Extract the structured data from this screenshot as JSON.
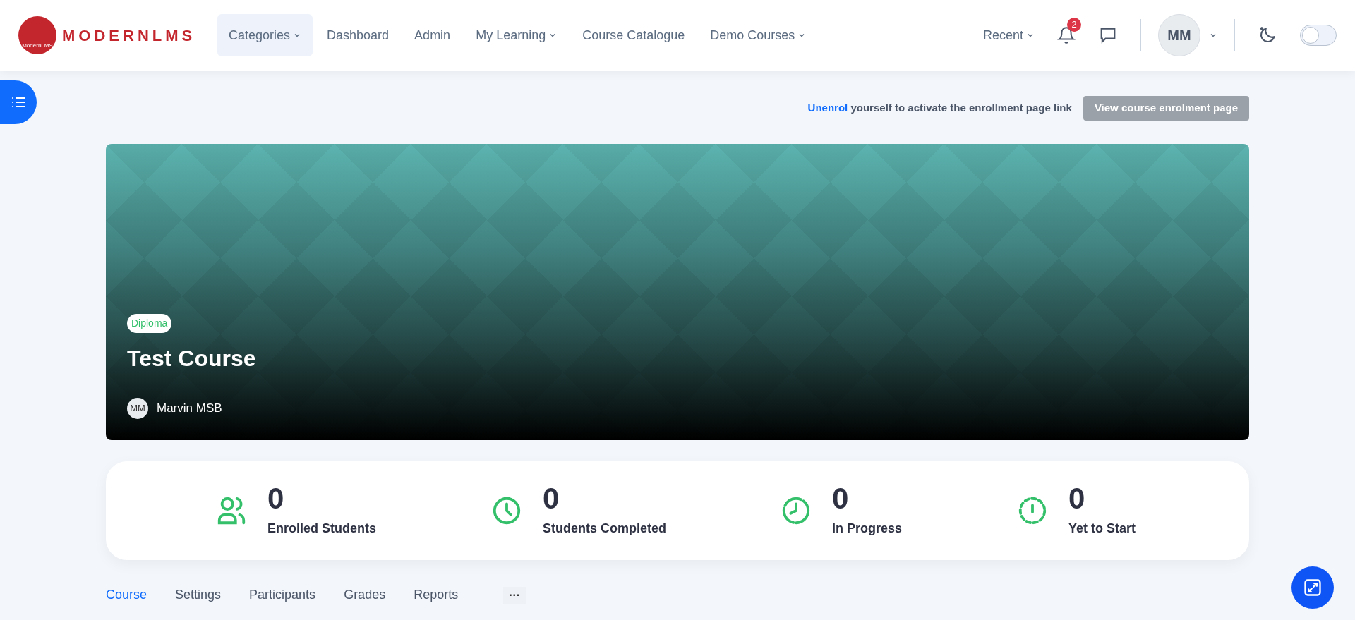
{
  "header": {
    "logo": {
      "text": "MODERNLMS",
      "badge_text": "ModernLMS"
    },
    "nav": [
      {
        "label": "Categories",
        "has_dropdown": true,
        "selected": true
      },
      {
        "label": "Dashboard",
        "has_dropdown": false,
        "selected": false
      },
      {
        "label": "Admin",
        "has_dropdown": false,
        "selected": false
      },
      {
        "label": "My Learning",
        "has_dropdown": true,
        "selected": false
      },
      {
        "label": "Course Catalogue",
        "has_dropdown": false,
        "selected": false
      },
      {
        "label": "Demo Courses",
        "has_dropdown": true,
        "selected": false
      }
    ],
    "recent": {
      "label": "Recent"
    },
    "notifications": {
      "count": "2"
    },
    "user": {
      "initials": "MM"
    },
    "dark_mode": {
      "on": false
    }
  },
  "notice": {
    "link": "Unenrol",
    "text": "yourself to activate the enrollment page link",
    "button": "View course enrolment page",
    "button_disabled": true
  },
  "hero": {
    "badge": "Diploma",
    "title": "Test Course",
    "teacher": {
      "initials": "MM",
      "name": "Marvin MSB"
    }
  },
  "stats": [
    {
      "kind": "users",
      "value": "0",
      "label": "Enrolled Students"
    },
    {
      "kind": "clock",
      "value": "0",
      "label": "Students Completed"
    },
    {
      "kind": "progress",
      "value": "0",
      "label": "In Progress"
    },
    {
      "kind": "pending",
      "value": "0",
      "label": "Yet to Start"
    }
  ],
  "tabs": [
    {
      "label": "Course",
      "selected": true
    },
    {
      "label": "Settings",
      "selected": false
    },
    {
      "label": "Participants",
      "selected": false
    },
    {
      "label": "Grades",
      "selected": false
    },
    {
      "label": "Reports",
      "selected": false
    }
  ],
  "more_tabs": {
    "label": "···"
  }
}
